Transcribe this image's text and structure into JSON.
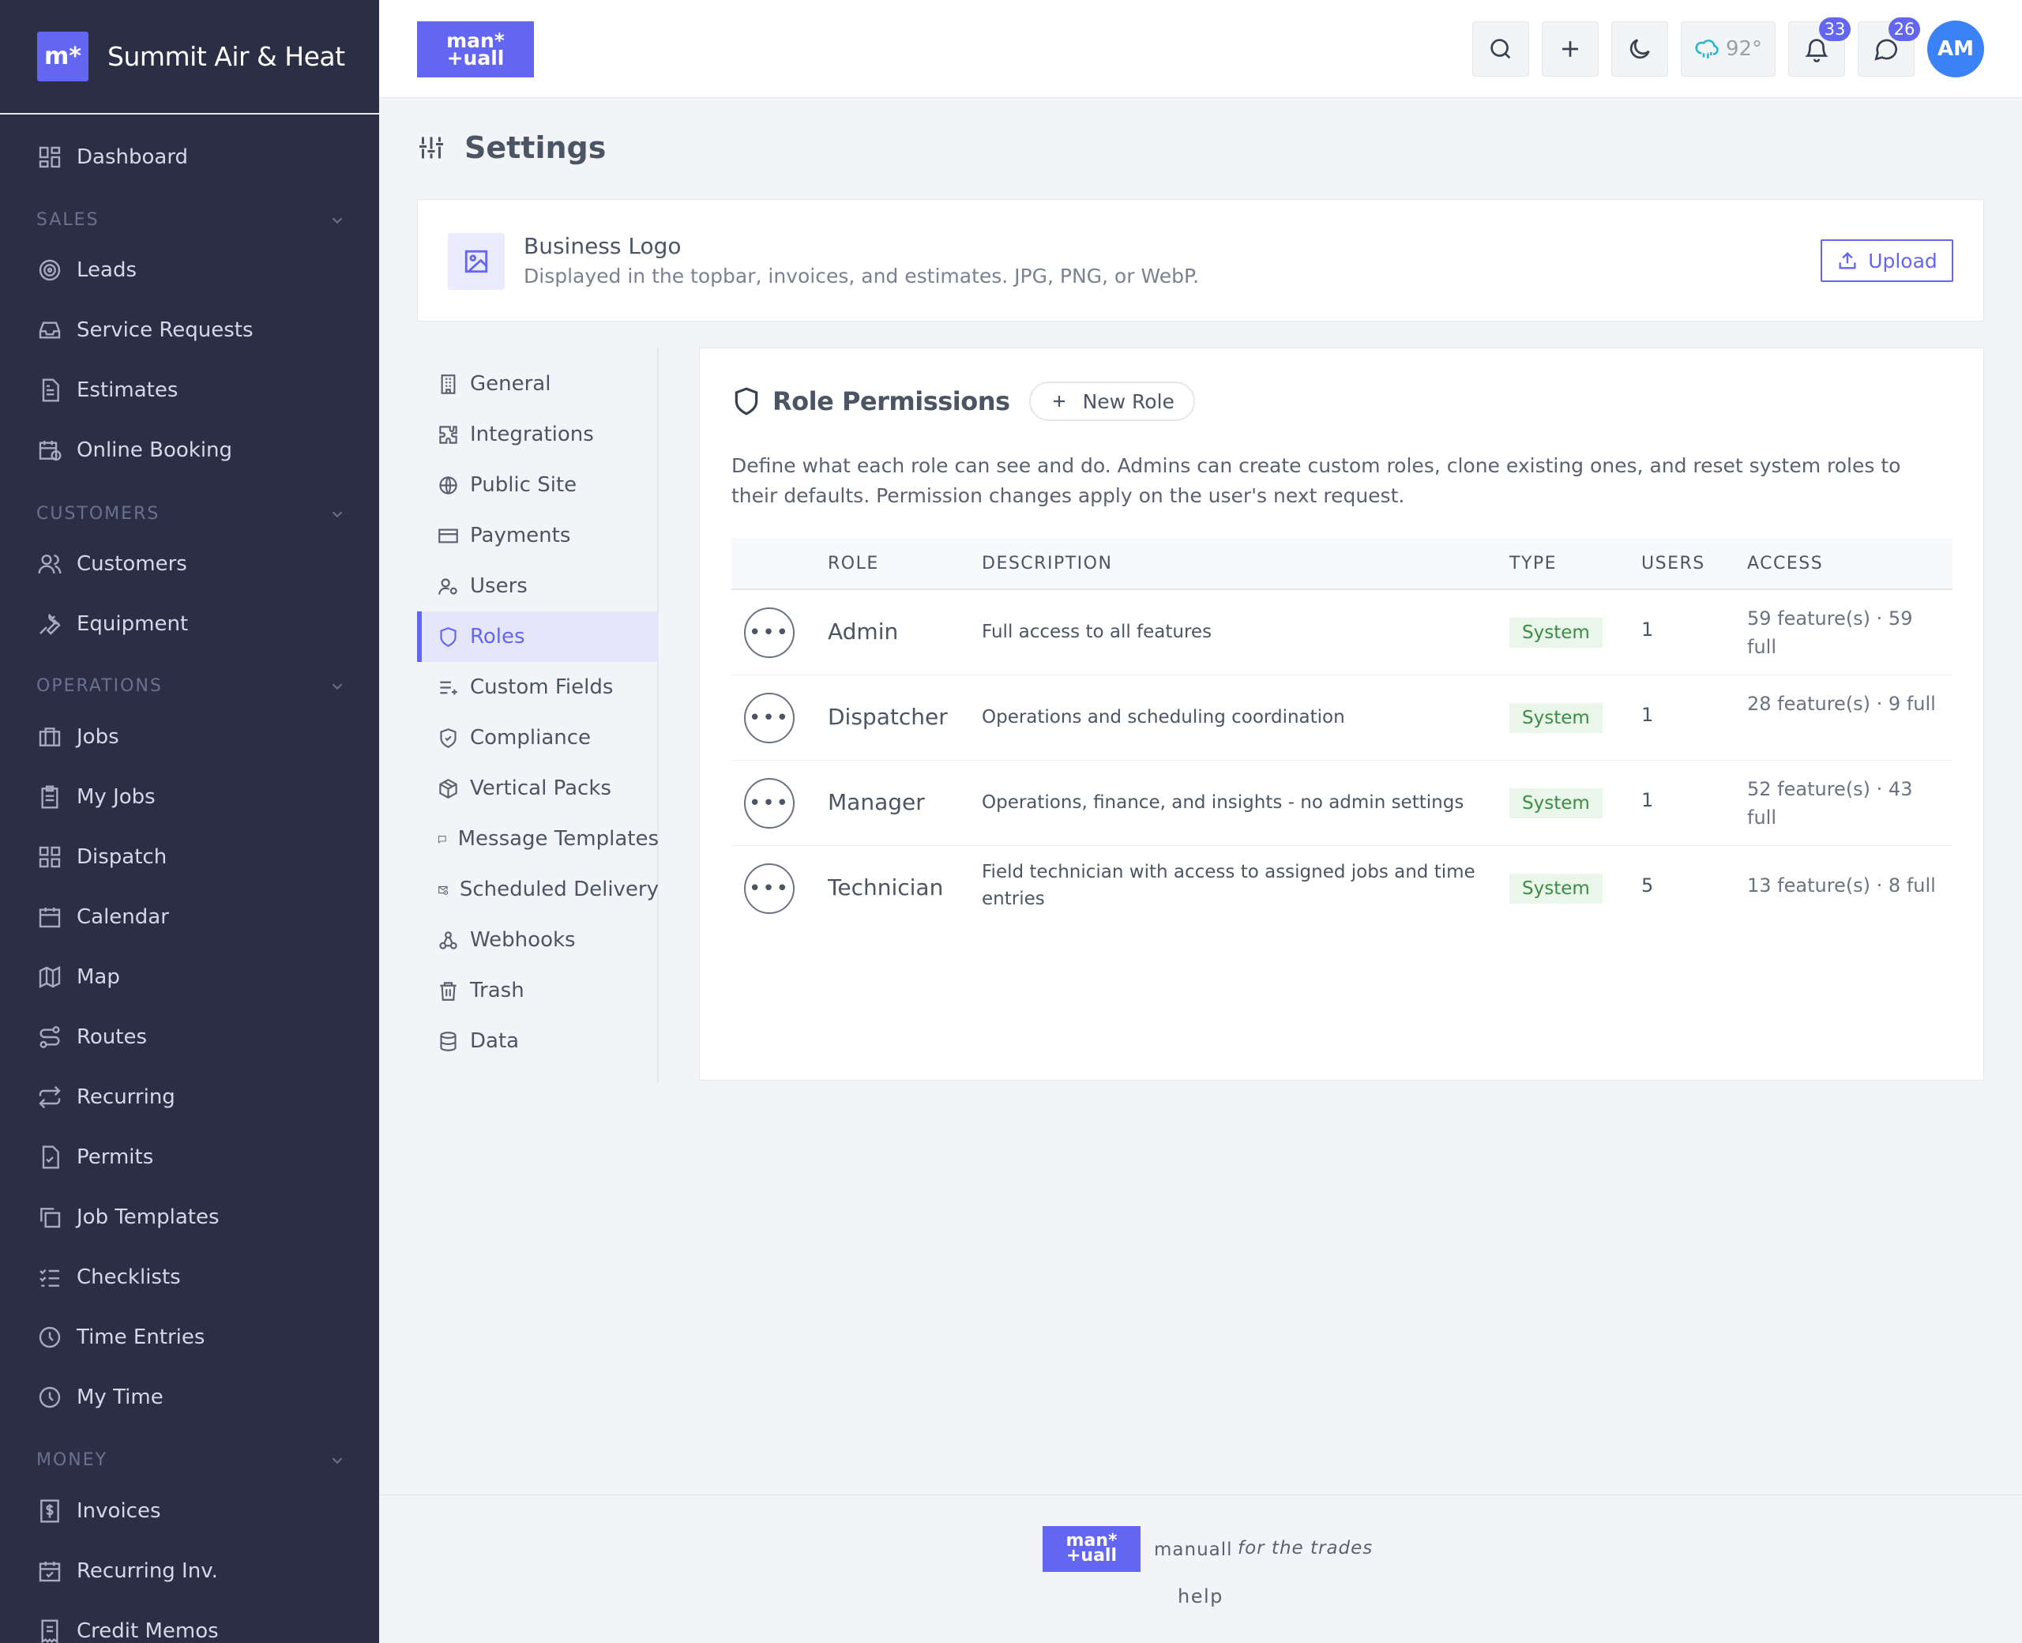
{
  "brand": {
    "name": "Summit Air & Heat",
    "logo_text": "m*"
  },
  "sidebar": {
    "dashboard": "Dashboard",
    "sections": {
      "sales": "SALES",
      "customers": "CUSTOMERS",
      "operations": "OPERATIONS",
      "money": "MONEY"
    },
    "items": {
      "leads": "Leads",
      "service_requests": "Service Requests",
      "estimates": "Estimates",
      "online_booking": "Online Booking",
      "customers": "Customers",
      "equipment": "Equipment",
      "jobs": "Jobs",
      "my_jobs": "My Jobs",
      "dispatch": "Dispatch",
      "calendar": "Calendar",
      "map": "Map",
      "routes": "Routes",
      "recurring": "Recurring",
      "permits": "Permits",
      "job_templates": "Job Templates",
      "checklists": "Checklists",
      "time_entries": "Time Entries",
      "my_time": "My Time",
      "invoices": "Invoices",
      "recurring_inv": "Recurring Inv.",
      "credit_memos": "Credit Memos"
    }
  },
  "topbar": {
    "logo_line1": "man*",
    "logo_line2": "+uall",
    "weather": "92°",
    "notifications_count": "33",
    "messages_count": "26",
    "avatar_initials": "AM"
  },
  "page": {
    "title": "Settings"
  },
  "business_logo": {
    "title": "Business Logo",
    "description": "Displayed in the topbar, invoices, and estimates. JPG, PNG, or WebP.",
    "upload_label": "Upload"
  },
  "settings_nav": {
    "general": "General",
    "integrations": "Integrations",
    "public_site": "Public Site",
    "payments": "Payments",
    "users": "Users",
    "roles": "Roles",
    "custom_fields": "Custom Fields",
    "compliance": "Compliance",
    "vertical_packs": "Vertical Packs",
    "message_templates": "Message Templates",
    "scheduled_delivery": "Scheduled Delivery",
    "webhooks": "Webhooks",
    "trash": "Trash",
    "data": "Data"
  },
  "roles_panel": {
    "title": "Role Permissions",
    "new_role_label": "New Role",
    "description": "Define what each role can see and do. Admins can create custom roles, clone existing ones, and reset system roles to their defaults. Permission changes apply on the user's next request.",
    "columns": {
      "role": "ROLE",
      "description": "DESCRIPTION",
      "type": "TYPE",
      "users": "USERS",
      "access": "ACCESS"
    },
    "rows": [
      {
        "role": "Admin",
        "description": "Full access to all features",
        "type": "System",
        "users": "1",
        "access": "59 feature(s) · 59 full"
      },
      {
        "role": "Dispatcher",
        "description": "Operations and scheduling coordination",
        "type": "System",
        "users": "1",
        "access": "28 feature(s) · 9 full"
      },
      {
        "role": "Manager",
        "description": "Operations, finance, and insights - no admin settings",
        "type": "System",
        "users": "1",
        "access": "52 feature(s) · 43 full"
      },
      {
        "role": "Technician",
        "description": "Field technician with access to assigned jobs and time entries",
        "type": "System",
        "users": "5",
        "access": "13 feature(s) · 8 full"
      }
    ]
  },
  "footer": {
    "logo_line1": "man*",
    "logo_line2": "+uall",
    "brand": "manuall",
    "tagline": "for the trades",
    "help": "help"
  }
}
